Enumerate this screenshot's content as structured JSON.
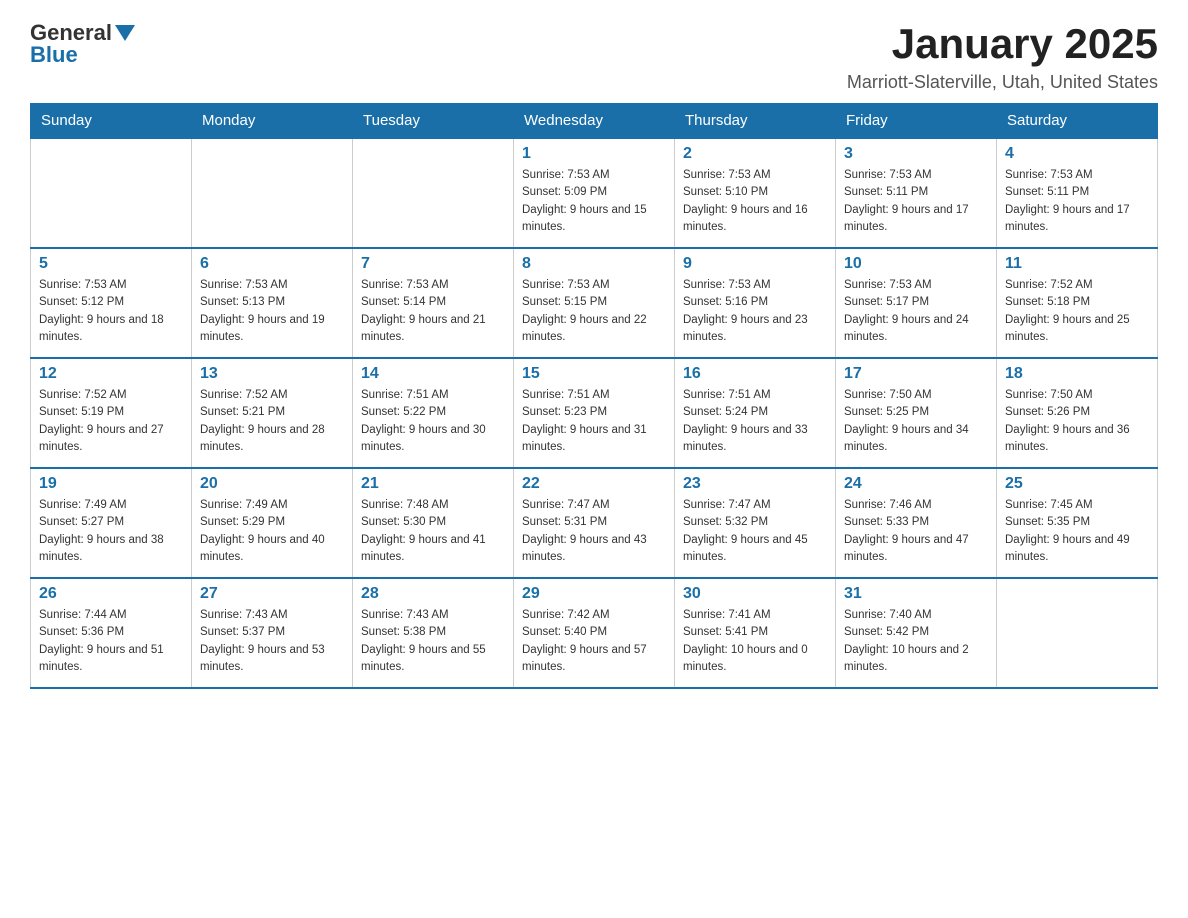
{
  "header": {
    "logo_general": "General",
    "logo_blue": "Blue",
    "main_title": "January 2025",
    "subtitle": "Marriott-Slaterville, Utah, United States"
  },
  "days": [
    "Sunday",
    "Monday",
    "Tuesday",
    "Wednesday",
    "Thursday",
    "Friday",
    "Saturday"
  ],
  "weeks": [
    [
      {
        "date": "",
        "sunrise": "",
        "sunset": "",
        "daylight": ""
      },
      {
        "date": "",
        "sunrise": "",
        "sunset": "",
        "daylight": ""
      },
      {
        "date": "",
        "sunrise": "",
        "sunset": "",
        "daylight": ""
      },
      {
        "date": "1",
        "sunrise": "Sunrise: 7:53 AM",
        "sunset": "Sunset: 5:09 PM",
        "daylight": "Daylight: 9 hours and 15 minutes."
      },
      {
        "date": "2",
        "sunrise": "Sunrise: 7:53 AM",
        "sunset": "Sunset: 5:10 PM",
        "daylight": "Daylight: 9 hours and 16 minutes."
      },
      {
        "date": "3",
        "sunrise": "Sunrise: 7:53 AM",
        "sunset": "Sunset: 5:11 PM",
        "daylight": "Daylight: 9 hours and 17 minutes."
      },
      {
        "date": "4",
        "sunrise": "Sunrise: 7:53 AM",
        "sunset": "Sunset: 5:11 PM",
        "daylight": "Daylight: 9 hours and 17 minutes."
      }
    ],
    [
      {
        "date": "5",
        "sunrise": "Sunrise: 7:53 AM",
        "sunset": "Sunset: 5:12 PM",
        "daylight": "Daylight: 9 hours and 18 minutes."
      },
      {
        "date": "6",
        "sunrise": "Sunrise: 7:53 AM",
        "sunset": "Sunset: 5:13 PM",
        "daylight": "Daylight: 9 hours and 19 minutes."
      },
      {
        "date": "7",
        "sunrise": "Sunrise: 7:53 AM",
        "sunset": "Sunset: 5:14 PM",
        "daylight": "Daylight: 9 hours and 21 minutes."
      },
      {
        "date": "8",
        "sunrise": "Sunrise: 7:53 AM",
        "sunset": "Sunset: 5:15 PM",
        "daylight": "Daylight: 9 hours and 22 minutes."
      },
      {
        "date": "9",
        "sunrise": "Sunrise: 7:53 AM",
        "sunset": "Sunset: 5:16 PM",
        "daylight": "Daylight: 9 hours and 23 minutes."
      },
      {
        "date": "10",
        "sunrise": "Sunrise: 7:53 AM",
        "sunset": "Sunset: 5:17 PM",
        "daylight": "Daylight: 9 hours and 24 minutes."
      },
      {
        "date": "11",
        "sunrise": "Sunrise: 7:52 AM",
        "sunset": "Sunset: 5:18 PM",
        "daylight": "Daylight: 9 hours and 25 minutes."
      }
    ],
    [
      {
        "date": "12",
        "sunrise": "Sunrise: 7:52 AM",
        "sunset": "Sunset: 5:19 PM",
        "daylight": "Daylight: 9 hours and 27 minutes."
      },
      {
        "date": "13",
        "sunrise": "Sunrise: 7:52 AM",
        "sunset": "Sunset: 5:21 PM",
        "daylight": "Daylight: 9 hours and 28 minutes."
      },
      {
        "date": "14",
        "sunrise": "Sunrise: 7:51 AM",
        "sunset": "Sunset: 5:22 PM",
        "daylight": "Daylight: 9 hours and 30 minutes."
      },
      {
        "date": "15",
        "sunrise": "Sunrise: 7:51 AM",
        "sunset": "Sunset: 5:23 PM",
        "daylight": "Daylight: 9 hours and 31 minutes."
      },
      {
        "date": "16",
        "sunrise": "Sunrise: 7:51 AM",
        "sunset": "Sunset: 5:24 PM",
        "daylight": "Daylight: 9 hours and 33 minutes."
      },
      {
        "date": "17",
        "sunrise": "Sunrise: 7:50 AM",
        "sunset": "Sunset: 5:25 PM",
        "daylight": "Daylight: 9 hours and 34 minutes."
      },
      {
        "date": "18",
        "sunrise": "Sunrise: 7:50 AM",
        "sunset": "Sunset: 5:26 PM",
        "daylight": "Daylight: 9 hours and 36 minutes."
      }
    ],
    [
      {
        "date": "19",
        "sunrise": "Sunrise: 7:49 AM",
        "sunset": "Sunset: 5:27 PM",
        "daylight": "Daylight: 9 hours and 38 minutes."
      },
      {
        "date": "20",
        "sunrise": "Sunrise: 7:49 AM",
        "sunset": "Sunset: 5:29 PM",
        "daylight": "Daylight: 9 hours and 40 minutes."
      },
      {
        "date": "21",
        "sunrise": "Sunrise: 7:48 AM",
        "sunset": "Sunset: 5:30 PM",
        "daylight": "Daylight: 9 hours and 41 minutes."
      },
      {
        "date": "22",
        "sunrise": "Sunrise: 7:47 AM",
        "sunset": "Sunset: 5:31 PM",
        "daylight": "Daylight: 9 hours and 43 minutes."
      },
      {
        "date": "23",
        "sunrise": "Sunrise: 7:47 AM",
        "sunset": "Sunset: 5:32 PM",
        "daylight": "Daylight: 9 hours and 45 minutes."
      },
      {
        "date": "24",
        "sunrise": "Sunrise: 7:46 AM",
        "sunset": "Sunset: 5:33 PM",
        "daylight": "Daylight: 9 hours and 47 minutes."
      },
      {
        "date": "25",
        "sunrise": "Sunrise: 7:45 AM",
        "sunset": "Sunset: 5:35 PM",
        "daylight": "Daylight: 9 hours and 49 minutes."
      }
    ],
    [
      {
        "date": "26",
        "sunrise": "Sunrise: 7:44 AM",
        "sunset": "Sunset: 5:36 PM",
        "daylight": "Daylight: 9 hours and 51 minutes."
      },
      {
        "date": "27",
        "sunrise": "Sunrise: 7:43 AM",
        "sunset": "Sunset: 5:37 PM",
        "daylight": "Daylight: 9 hours and 53 minutes."
      },
      {
        "date": "28",
        "sunrise": "Sunrise: 7:43 AM",
        "sunset": "Sunset: 5:38 PM",
        "daylight": "Daylight: 9 hours and 55 minutes."
      },
      {
        "date": "29",
        "sunrise": "Sunrise: 7:42 AM",
        "sunset": "Sunset: 5:40 PM",
        "daylight": "Daylight: 9 hours and 57 minutes."
      },
      {
        "date": "30",
        "sunrise": "Sunrise: 7:41 AM",
        "sunset": "Sunset: 5:41 PM",
        "daylight": "Daylight: 10 hours and 0 minutes."
      },
      {
        "date": "31",
        "sunrise": "Sunrise: 7:40 AM",
        "sunset": "Sunset: 5:42 PM",
        "daylight": "Daylight: 10 hours and 2 minutes."
      },
      {
        "date": "",
        "sunrise": "",
        "sunset": "",
        "daylight": ""
      }
    ]
  ]
}
